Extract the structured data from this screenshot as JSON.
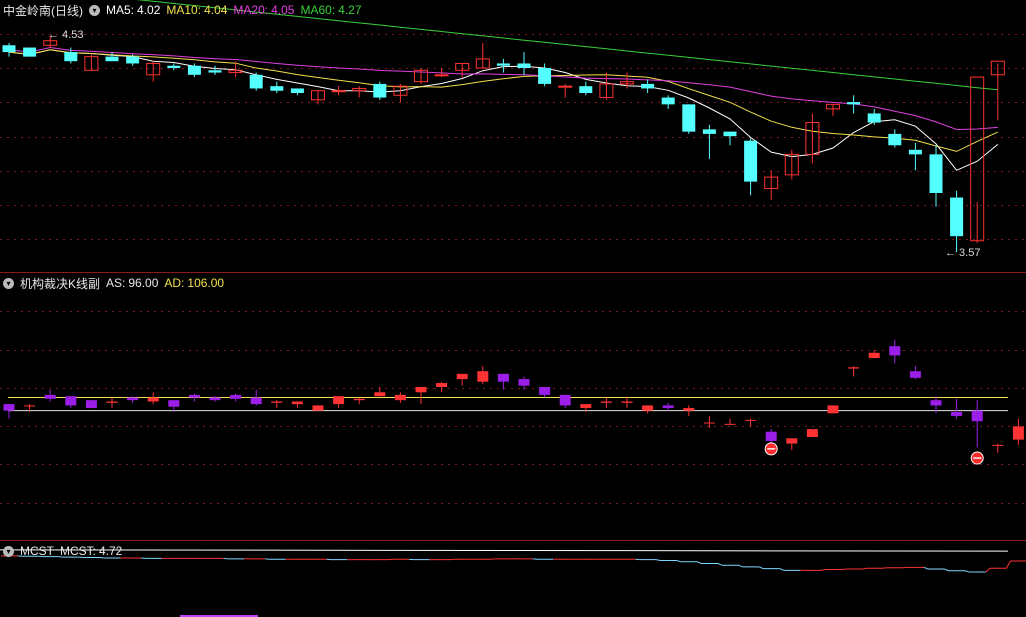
{
  "price_panel": {
    "symbol": "中金岭南(日线)",
    "indicators": [
      {
        "name": "MA5:",
        "value": "4.02",
        "color": "#ffffff"
      },
      {
        "name": "MA10:",
        "value": "4.04",
        "color": "#f2e04e"
      },
      {
        "name": "MA20:",
        "value": "4.05",
        "color": "#e040e0"
      },
      {
        "name": "MA60:",
        "value": "4.27",
        "color": "#39d039"
      }
    ],
    "high_mark": "4.53",
    "low_mark": "3.57"
  },
  "sub_panel": {
    "title": "机构裁决K线副",
    "indicators": [
      {
        "name": "AS:",
        "value": "96.00",
        "color": "#e8e8e8"
      },
      {
        "name": "AD:",
        "value": "106.00",
        "color": "#f2e04e"
      }
    ]
  },
  "mcst_panel": {
    "title": "MCST",
    "indicators": [
      {
        "name": "MCST:",
        "value": "4.72",
        "color": "#e8e8e8"
      }
    ]
  },
  "colors": {
    "up": "#ff3333",
    "down": "#54ffff",
    "purple": "#9b1fe8",
    "grid": "#7a1a1a",
    "border": "#8b1a1a"
  },
  "chart_data": [
    {
      "type": "candlestick",
      "title": "中金岭南(日线)",
      "ylim": [
        3.5,
        4.6
      ],
      "high_label": 4.53,
      "low_label": 3.57,
      "ohlc": [
        [
          4.48,
          4.49,
          4.45,
          4.43
        ],
        [
          4.47,
          4.47,
          4.43,
          4.43
        ],
        [
          4.48,
          4.52,
          4.5,
          4.47
        ],
        [
          4.45,
          4.47,
          4.41,
          4.4
        ],
        [
          4.37,
          4.44,
          4.43,
          4.37
        ],
        [
          4.43,
          4.45,
          4.41,
          4.41
        ],
        [
          4.43,
          4.44,
          4.4,
          4.39
        ],
        [
          4.35,
          4.41,
          4.4,
          4.32
        ],
        [
          4.39,
          4.4,
          4.38,
          4.37
        ],
        [
          4.39,
          4.4,
          4.35,
          4.34
        ],
        [
          4.37,
          4.39,
          4.36,
          4.35
        ],
        [
          4.36,
          4.41,
          4.37,
          4.34
        ],
        [
          4.35,
          4.36,
          4.29,
          4.28
        ],
        [
          4.3,
          4.32,
          4.28,
          4.27
        ],
        [
          4.29,
          4.29,
          4.27,
          4.26
        ],
        [
          4.24,
          4.28,
          4.28,
          4.22
        ],
        [
          4.28,
          4.3,
          4.28,
          4.26
        ],
        [
          4.28,
          4.3,
          4.29,
          4.25
        ],
        [
          4.31,
          4.32,
          4.25,
          4.24
        ],
        [
          4.26,
          4.31,
          4.3,
          4.23
        ],
        [
          4.32,
          4.38,
          4.37,
          4.31
        ],
        [
          4.35,
          4.38,
          4.35,
          4.34
        ],
        [
          4.37,
          4.4,
          4.4,
          4.34
        ],
        [
          4.38,
          4.49,
          4.42,
          4.38
        ],
        [
          4.4,
          4.42,
          4.39,
          4.36
        ],
        [
          4.4,
          4.45,
          4.38,
          4.35
        ],
        [
          4.38,
          4.4,
          4.31,
          4.3
        ],
        [
          4.3,
          4.31,
          4.3,
          4.25
        ],
        [
          4.3,
          4.32,
          4.27,
          4.26
        ],
        [
          4.25,
          4.36,
          4.31,
          4.24
        ],
        [
          4.31,
          4.36,
          4.32,
          4.29
        ],
        [
          4.31,
          4.33,
          4.29,
          4.27
        ],
        [
          4.25,
          4.26,
          4.22,
          4.2
        ],
        [
          4.22,
          4.22,
          4.1,
          4.09
        ],
        [
          4.11,
          4.13,
          4.09,
          3.98
        ],
        [
          4.1,
          4.1,
          4.08,
          4.04
        ],
        [
          4.06,
          4.07,
          3.88,
          3.82
        ],
        [
          3.85,
          3.93,
          3.9,
          3.8
        ],
        [
          3.91,
          4.02,
          4.0,
          3.89
        ],
        [
          4.0,
          4.18,
          4.14,
          3.96
        ],
        [
          4.2,
          4.22,
          4.22,
          4.17
        ],
        [
          4.23,
          4.26,
          4.22,
          4.18
        ],
        [
          4.18,
          4.2,
          4.14,
          4.13
        ],
        [
          4.09,
          4.11,
          4.04,
          4.03
        ],
        [
          4.02,
          4.05,
          4.0,
          3.93
        ],
        [
          4.0,
          4.04,
          3.83,
          3.77
        ],
        [
          3.81,
          3.84,
          3.64,
          3.57
        ],
        [
          3.62,
          3.79,
          4.34,
          3.61
        ],
        [
          4.35,
          4.4,
          4.41,
          4.15
        ]
      ]
    },
    {
      "type": "candlestick",
      "title": "机构裁决K线副",
      "ylim": [
        0,
        190
      ],
      "lines": [
        {
          "name": "AS",
          "value": 96.0
        },
        {
          "name": "AD",
          "value": 106.0
        }
      ],
      "ohlc": [
        [
          101,
          101,
          96,
          90
        ],
        [
          100,
          101,
          100,
          95
        ],
        [
          108,
          112,
          105,
          103
        ],
        [
          107,
          107,
          100,
          98
        ],
        [
          104,
          104,
          98,
          98
        ],
        [
          102,
          106,
          103,
          98
        ],
        [
          106,
          107,
          104,
          102
        ],
        [
          103,
          110,
          106,
          101
        ],
        [
          104,
          104,
          99,
          95
        ],
        [
          108,
          109,
          106,
          103
        ],
        [
          106,
          107,
          104,
          103
        ],
        [
          108,
          109,
          105,
          103
        ],
        [
          106,
          112,
          101,
          100
        ],
        [
          102,
          104,
          103,
          98
        ],
        [
          101,
          103,
          103,
          98
        ],
        [
          96,
          98,
          100,
          97
        ],
        [
          101,
          106,
          107,
          98
        ],
        [
          104,
          106,
          105,
          101
        ],
        [
          107,
          114,
          110,
          108
        ],
        [
          104,
          110,
          108,
          102
        ],
        [
          110,
          112,
          114,
          101
        ],
        [
          114,
          118,
          117,
          110
        ],
        [
          120,
          122,
          124,
          115
        ],
        [
          118,
          130,
          126,
          116
        ],
        [
          124,
          124,
          118,
          112
        ],
        [
          120,
          122,
          115,
          112
        ],
        [
          114,
          113,
          108,
          106
        ],
        [
          108,
          108,
          100,
          98
        ],
        [
          98,
          100,
          101,
          95
        ],
        [
          102,
          106,
          103,
          98
        ],
        [
          102,
          106,
          103,
          98
        ],
        [
          96,
          100,
          100,
          94
        ],
        [
          100,
          102,
          98,
          96
        ],
        [
          96,
          100,
          98,
          92
        ],
        [
          87,
          92,
          87,
          83
        ],
        [
          86,
          90,
          86,
          86
        ],
        [
          89,
          90,
          89,
          84
        ],
        [
          80,
          82,
          73,
          71
        ],
        [
          71,
          75,
          75,
          66
        ],
        [
          76,
          75,
          82,
          75
        ],
        [
          94,
          95,
          100,
          94
        ],
        [
          128,
          130,
          129,
          122
        ],
        [
          136,
          142,
          140,
          136
        ],
        [
          145,
          150,
          138,
          132
        ],
        [
          126,
          130,
          121,
          120
        ],
        [
          104,
          107,
          100,
          94
        ],
        [
          95,
          105,
          92,
          90
        ],
        [
          96,
          104,
          88,
          68
        ],
        [
          70,
          71,
          70,
          64
        ],
        [
          74,
          90,
          84,
          70
        ],
        [
          144,
          146,
          161,
          142
        ],
        [
          151,
          157,
          162,
          146
        ]
      ],
      "signals": [
        {
          "index": 37,
          "value": 67
        },
        {
          "index": 47,
          "value": 60
        }
      ]
    },
    {
      "type": "step-line",
      "title": "MCST",
      "ylim": [
        3.5,
        5.0
      ],
      "series": [
        {
          "name": "MCST",
          "values": [
            4.84,
            4.83,
            4.82,
            4.81,
            4.8,
            4.79,
            4.79,
            4.78,
            4.78,
            4.78,
            4.78,
            4.77,
            4.77,
            4.76,
            4.76,
            4.76,
            4.75,
            4.75,
            4.75,
            4.76,
            4.75,
            4.75,
            4.76,
            4.76,
            4.77,
            4.77,
            4.76,
            4.76,
            4.76,
            4.76,
            4.76,
            4.75,
            4.73,
            4.7,
            4.66,
            4.62,
            4.58,
            4.54,
            4.5,
            4.5,
            4.52,
            4.53,
            4.55,
            4.56,
            4.57,
            4.53,
            4.49,
            4.46,
            4.55,
            4.72
          ]
        },
        {
          "name": "upper",
          "values": [
            4.98,
            4.95
          ]
        }
      ]
    }
  ]
}
